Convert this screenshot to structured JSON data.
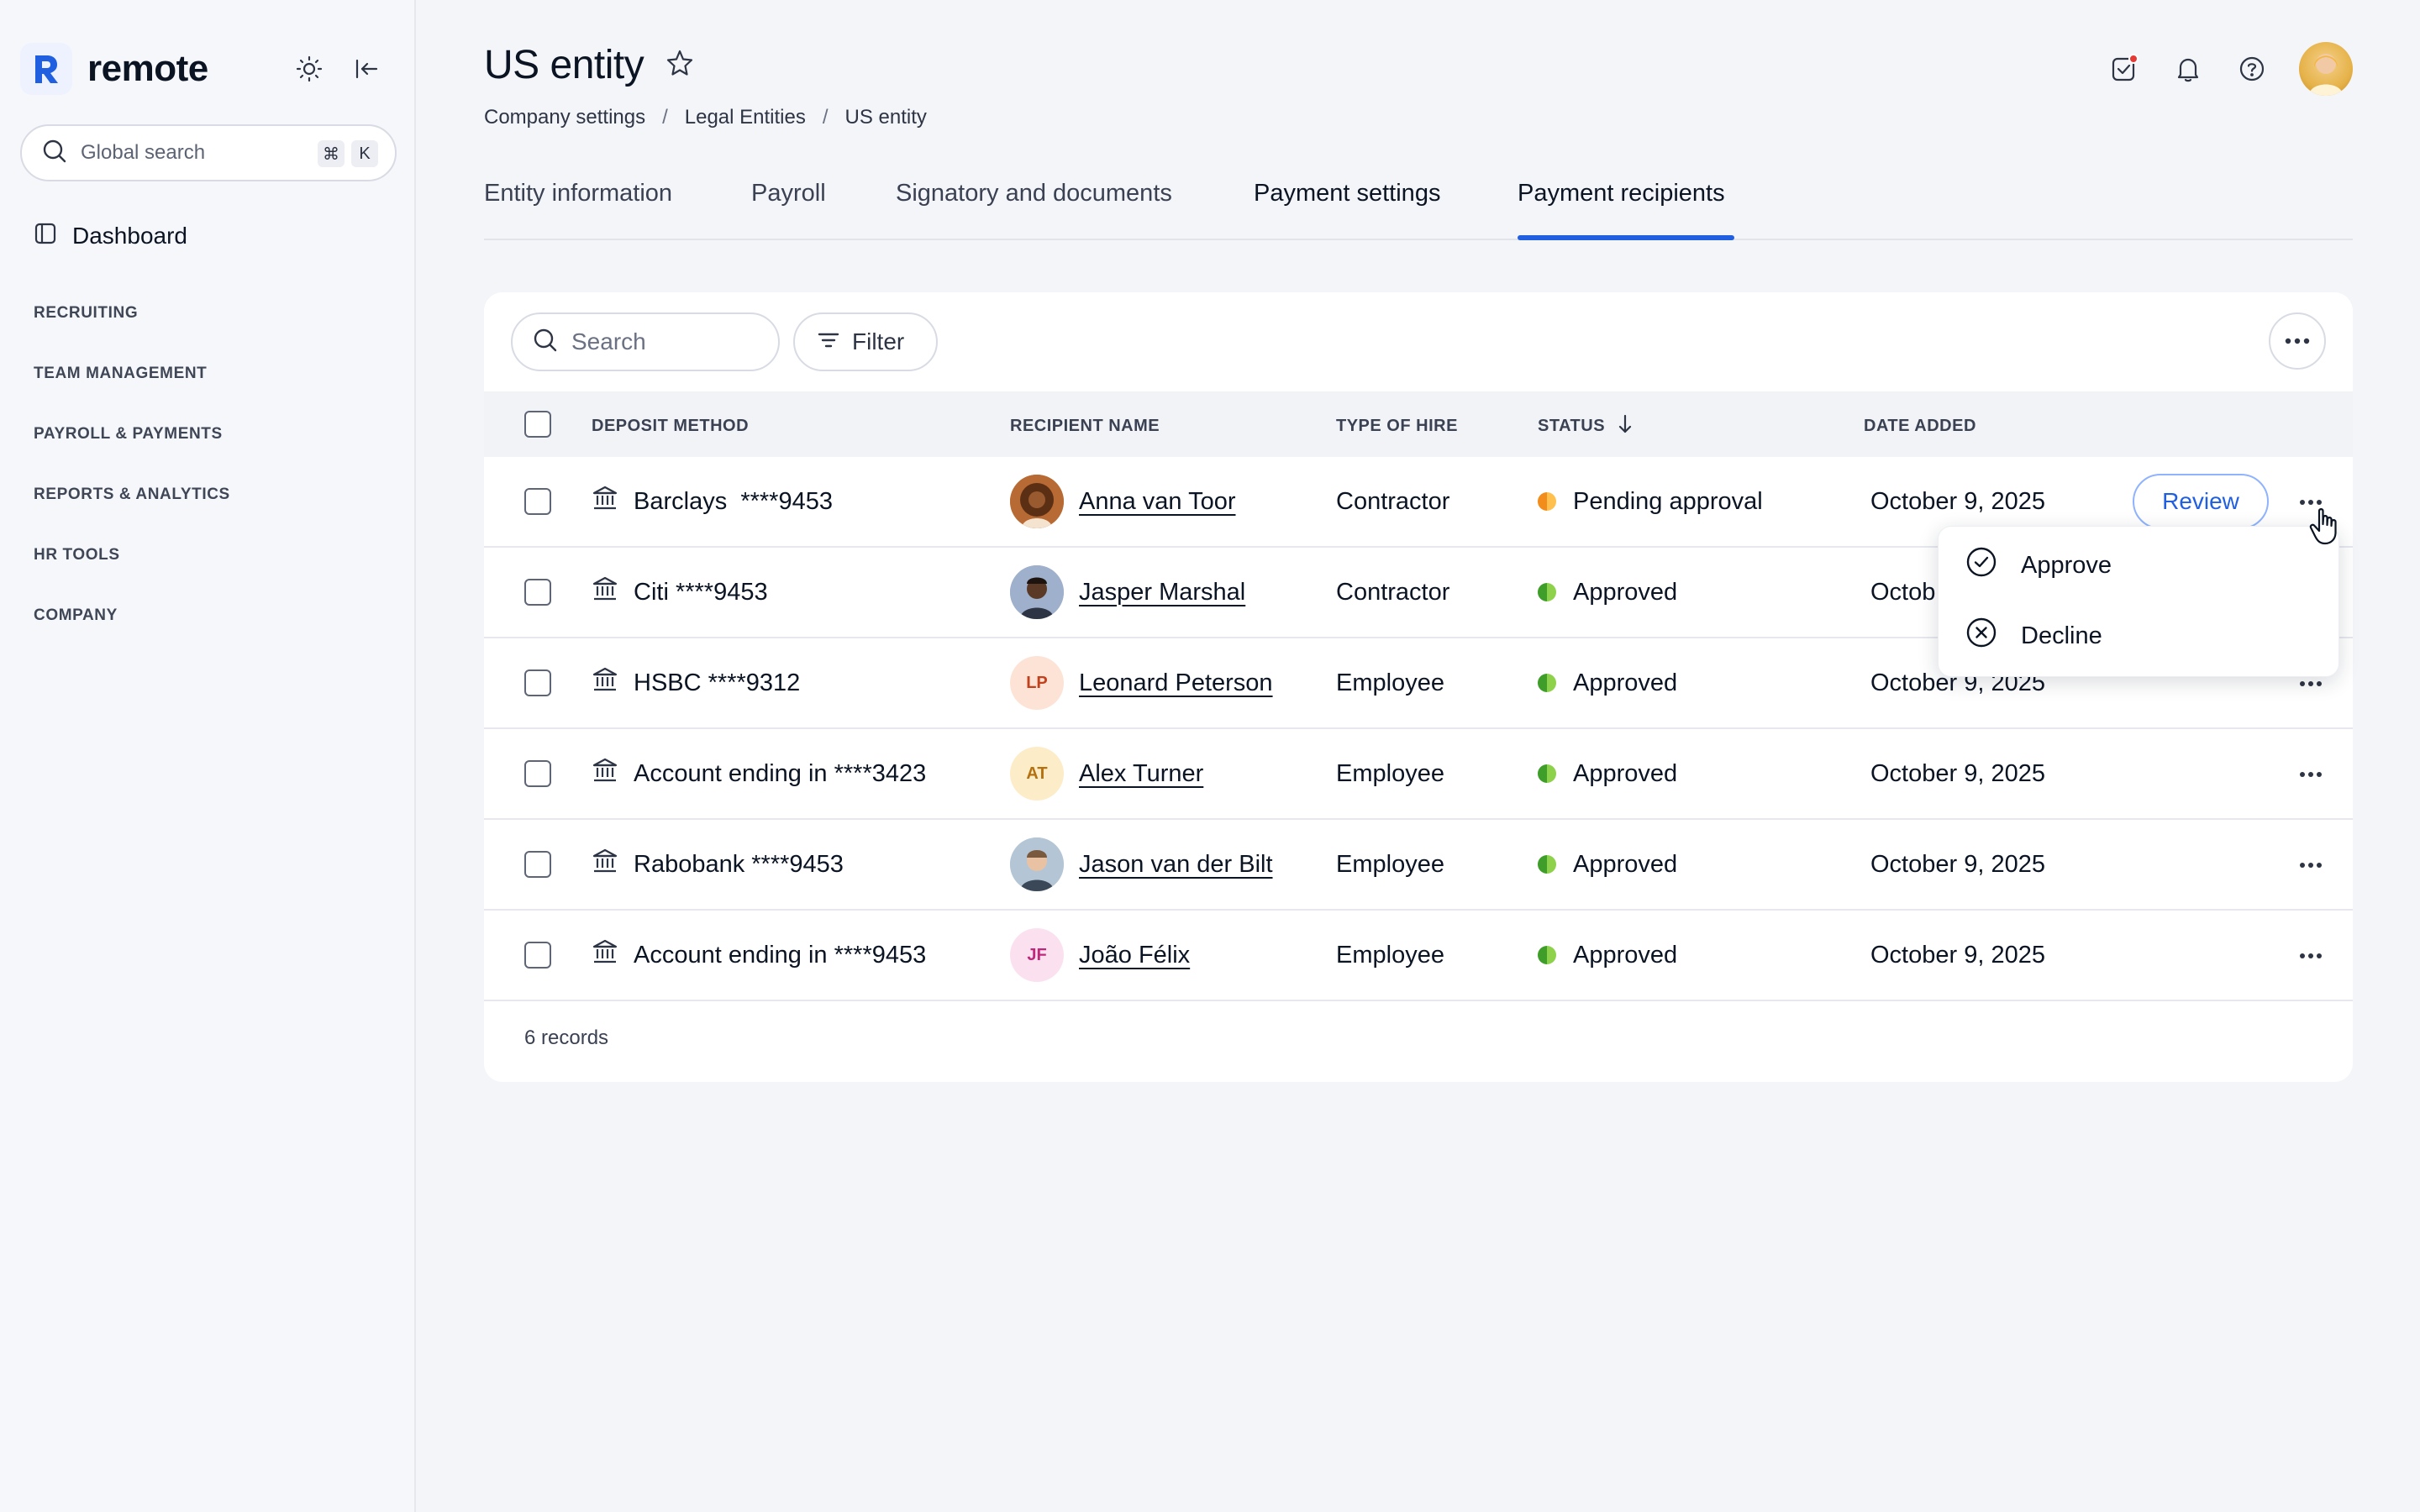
{
  "app": {
    "brand": "remote",
    "global_search_placeholder": "Global search",
    "shortcut_keys": [
      "⌘",
      "K"
    ],
    "nav": {
      "dashboard": "Dashboard",
      "sections": [
        "RECRUITING",
        "TEAM MANAGEMENT",
        "PAYROLL & PAYMENTS",
        "REPORTS & ANALYTICS",
        "HR TOOLS",
        "COMPANY"
      ]
    }
  },
  "header": {
    "title": "US entity",
    "breadcrumb": [
      "Company settings",
      "Legal Entities",
      "US entity"
    ]
  },
  "tabs": [
    {
      "label": "Entity information",
      "active": false
    },
    {
      "label": "Payroll",
      "active": false
    },
    {
      "label": "Signatory and documents",
      "active": false
    },
    {
      "label": "Payment settings",
      "active": false
    },
    {
      "label": "Payment recipients",
      "active": true
    }
  ],
  "toolbar": {
    "search_placeholder": "Search",
    "filter_label": "Filter"
  },
  "table": {
    "columns": [
      "DEPOSIT METHOD",
      "RECIPIENT NAME",
      "TYPE OF HIRE",
      "STATUS",
      "DATE ADDED"
    ],
    "rows": [
      {
        "deposit": "Barclays  ****9453",
        "name": "Anna van Toor",
        "initials": "",
        "type": "Contractor",
        "status": "Pending approval",
        "date": "October 9, 2025"
      },
      {
        "deposit": "Citi ****9453",
        "name": "Jasper Marshal",
        "initials": "",
        "type": "Contractor",
        "status": "Approved",
        "date": "Octob"
      },
      {
        "deposit": "HSBC ****9312",
        "name": "Leonard Peterson",
        "initials": "LP",
        "type": "Employee",
        "status": "Approved",
        "date": "October 9, 2025"
      },
      {
        "deposit": "Account ending in ****3423",
        "name": "Alex Turner",
        "initials": "AT",
        "type": "Employee",
        "status": "Approved",
        "date": "October 9, 2025"
      },
      {
        "deposit": "Rabobank ****9453",
        "name": "Jason van der Bilt",
        "initials": "",
        "type": "Employee",
        "status": "Approved",
        "date": "October 9, 2025"
      },
      {
        "deposit": "Account ending in ****9453",
        "name": "João Félix",
        "initials": "JF",
        "type": "Employee",
        "status": "Approved",
        "date": "October 9, 2025"
      }
    ],
    "review_label": "Review",
    "records": "6 records"
  },
  "menu": {
    "items": [
      "Approve",
      "Decline"
    ]
  },
  "colors": {
    "accent": "#1f5fe0",
    "approved": "#3f9e2a",
    "pending": "#f28c1b"
  }
}
